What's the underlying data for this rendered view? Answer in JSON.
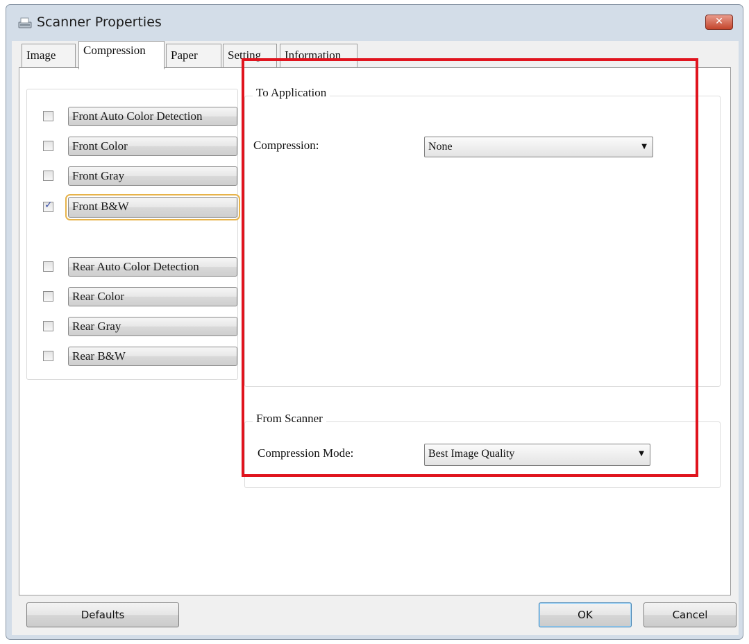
{
  "window": {
    "title": "Scanner Properties",
    "close_label": "✕",
    "accent_color": "#e0141e"
  },
  "tabs": [
    {
      "label": "Image",
      "active": false
    },
    {
      "label": "Compression",
      "active": true
    },
    {
      "label": "Paper",
      "active": false
    },
    {
      "label": "Setting",
      "active": false
    },
    {
      "label": "Information",
      "active": false
    }
  ],
  "image_types": {
    "front_auto": {
      "label": "Front Auto Color Detection",
      "checked": false
    },
    "front_color": {
      "label": "Front Color",
      "checked": false
    },
    "front_gray": {
      "label": "Front Gray",
      "checked": false
    },
    "front_bw": {
      "label": "Front B&W",
      "checked": true,
      "check_glyph": "✓"
    },
    "rear_auto": {
      "label": "Rear Auto Color Detection",
      "checked": false
    },
    "rear_color": {
      "label": "Rear Color",
      "checked": false
    },
    "rear_gray": {
      "label": "Rear Gray",
      "checked": false
    },
    "rear_bw": {
      "label": "Rear B&W",
      "checked": false
    }
  },
  "to_application": {
    "legend": "To Application",
    "compression_label": "Compression:",
    "compression_value": "None"
  },
  "from_scanner": {
    "legend": "From Scanner",
    "mode_label": "Compression Mode:",
    "mode_value": "Best Image Quality"
  },
  "footer": {
    "defaults_label": "Defaults",
    "ok_label": "OK",
    "cancel_label": "Cancel"
  },
  "icons": {
    "dropdown_arrow": "▼"
  }
}
